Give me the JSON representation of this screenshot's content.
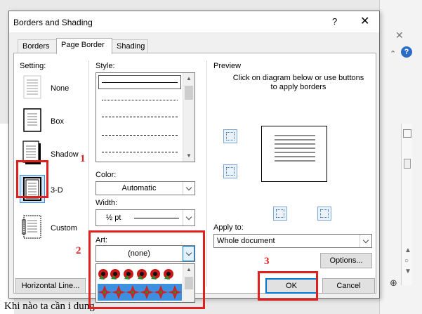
{
  "dialog": {
    "title": "Borders and Shading",
    "help_label": "?",
    "close_label": "✕"
  },
  "tabs": [
    {
      "label": "Borders",
      "active": false
    },
    {
      "label": "Page Border",
      "active": true
    },
    {
      "label": "Shading",
      "active": false
    }
  ],
  "setting": {
    "label": "Setting:",
    "items": [
      {
        "label": "None",
        "icon": "setting-none-icon"
      },
      {
        "label": "Box",
        "icon": "setting-box-icon"
      },
      {
        "label": "Shadow",
        "icon": "setting-shadow-icon"
      },
      {
        "label": "3-D",
        "icon": "setting-3d-icon",
        "selected": true
      },
      {
        "label": "Custom",
        "icon": "setting-custom-icon"
      }
    ]
  },
  "style": {
    "label": "Style:"
  },
  "color": {
    "label": "Color:",
    "value": "Automatic"
  },
  "width": {
    "label": "Width:",
    "value": "½ pt"
  },
  "art": {
    "label": "Art:",
    "value": "(none)"
  },
  "preview": {
    "label": "Preview",
    "hint": "Click on diagram below or use buttons to apply borders"
  },
  "apply_to": {
    "label": "Apply to:",
    "value": "Whole document"
  },
  "buttons": {
    "options": "Options...",
    "horizontal_line": "Horizontal Line...",
    "ok": "OK",
    "cancel": "Cancel"
  },
  "annotations": [
    "1",
    "2",
    "3"
  ],
  "background": {
    "doc_text": "Khi nào ta cần                                   i dung",
    "close_label": "✕",
    "help_label": "?"
  },
  "colors": {
    "annotation_red": "#e02020",
    "default_button_border": "#0078d7",
    "art_selected_bg": "#3d8fe0"
  }
}
